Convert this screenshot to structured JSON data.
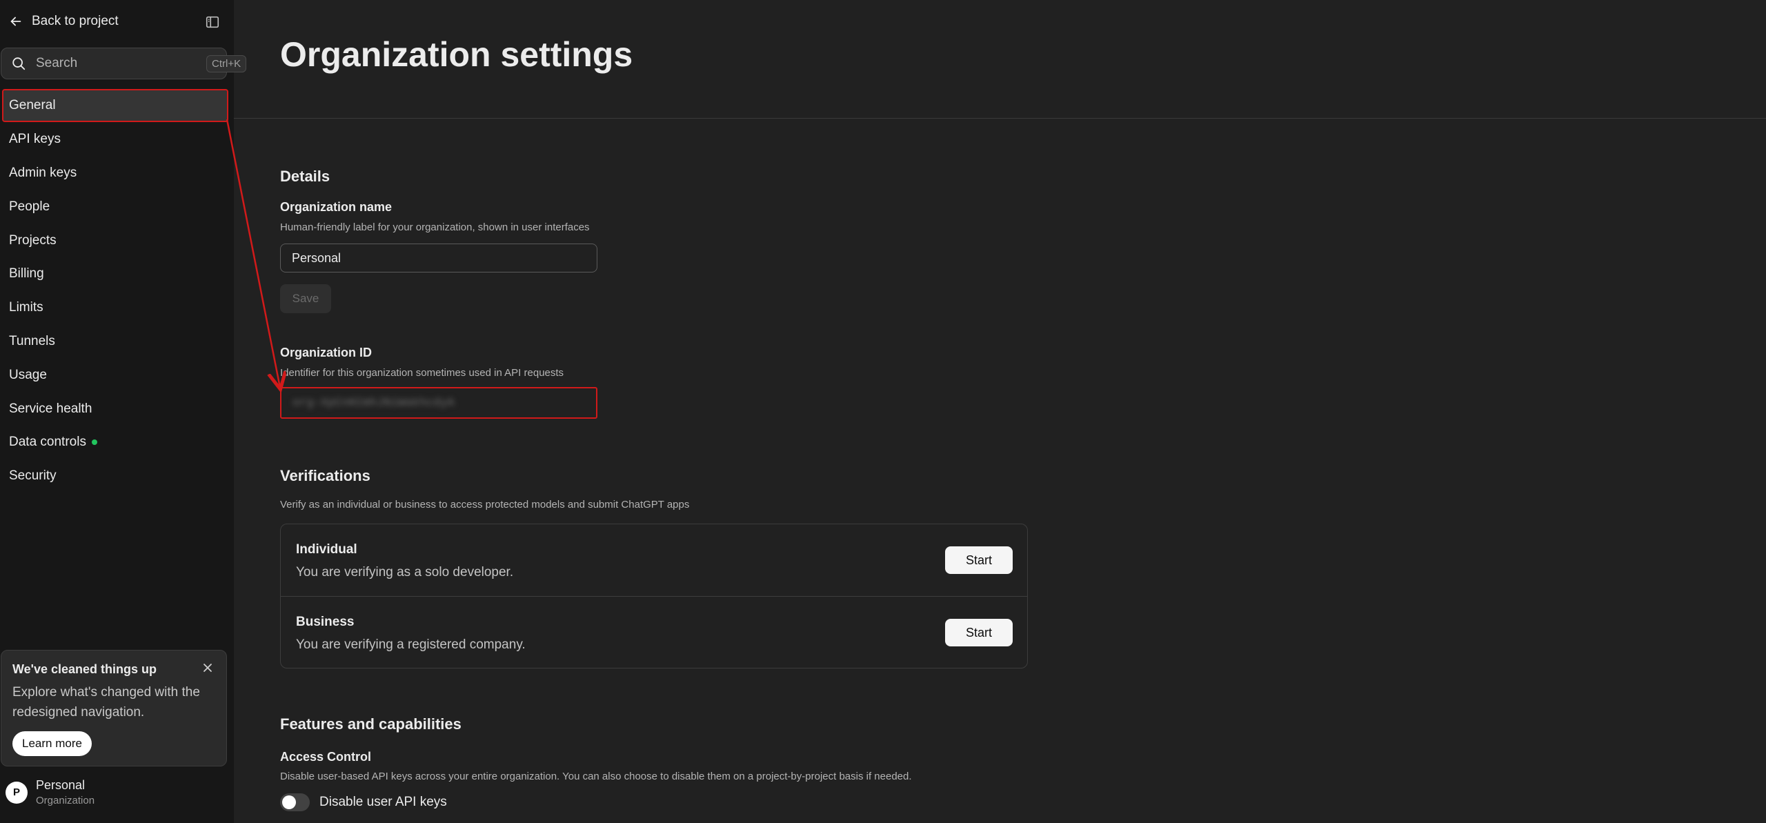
{
  "sidebar": {
    "back_label": "Back to project",
    "search_placeholder": "Search",
    "search_shortcut": "Ctrl+K",
    "items": [
      {
        "label": "General"
      },
      {
        "label": "API keys"
      },
      {
        "label": "Admin keys"
      },
      {
        "label": "People"
      },
      {
        "label": "Projects"
      },
      {
        "label": "Billing"
      },
      {
        "label": "Limits"
      },
      {
        "label": "Tunnels"
      },
      {
        "label": "Usage"
      },
      {
        "label": "Service health"
      },
      {
        "label": "Data controls"
      },
      {
        "label": "Security"
      }
    ],
    "active_item": "General",
    "promo": {
      "title": "We've cleaned things up",
      "body": "Explore what's changed with the redesigned navigation.",
      "button": "Learn more"
    },
    "account": {
      "initial": "P",
      "name": "Personal",
      "type": "Organization"
    }
  },
  "main": {
    "title": "Organization settings",
    "details": {
      "heading": "Details",
      "org_name_label": "Organization name",
      "org_name_help": "Human-friendly label for your organization, shown in user interfaces",
      "org_name_value": "Personal",
      "save_label": "Save",
      "org_id_label": "Organization ID",
      "org_id_help": "Identifier for this organization sometimes used in API requests",
      "org_id_value": "org-XpCnKCmhJNiWakhcdyA"
    },
    "verifications": {
      "heading": "Verifications",
      "description": "Verify as an individual or business to access protected models and submit ChatGPT apps",
      "rows": [
        {
          "title": "Individual",
          "desc": "You are verifying as a solo developer.",
          "button": "Start"
        },
        {
          "title": "Business",
          "desc": "You are verifying a registered company.",
          "button": "Start"
        }
      ]
    },
    "features": {
      "heading": "Features and capabilities",
      "access_label": "Access Control",
      "access_help": "Disable user-based API keys across your entire organization. You can also choose to disable them on a project-by-project basis if needed.",
      "toggle_label": "Disable user API keys",
      "toggle_on": false
    }
  },
  "colors": {
    "annotation": "#d11a1a",
    "status_dot": "#22c55e"
  }
}
